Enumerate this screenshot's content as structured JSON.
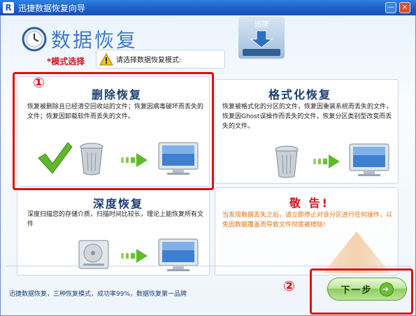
{
  "window": {
    "title": "迅捷数据恢复向导",
    "logo_letter": "R",
    "minimize_glyph": "—",
    "close_glyph": "×"
  },
  "header": {
    "title": "数据恢复",
    "mode_label": "*模式选择",
    "notice": "请选择数据恢复模式:",
    "drive_label": "迅捷"
  },
  "panels": {
    "delete": {
      "title": "删除恢复",
      "desc": "恢复被删除且已经清空回收站的文件；恢复因病毒破坏而丢失的文件；恢复因卸载软件而丢失的文件。",
      "marker": "①"
    },
    "format": {
      "title": "格式化恢复",
      "desc": "恢复被格式化的分区的文件，恢复因重装系统而丢失的文件，恢复因Ghost误操作而丢失的文件，恢复分区类别型改变而丢失的文件。"
    },
    "deep": {
      "title": "深度恢复",
      "desc": "深度扫描您的存储介质，扫描时间比较长，理论上能恢复所有文件"
    },
    "warning": {
      "title": "敬 告!",
      "desc": "当发现数据丢失之后，请立即停止对该分区进行任何操作，以免因数据覆盖而导致文件彻底被擦除!"
    }
  },
  "footer": {
    "text": "迅捷数据恢复，三种恢复模式，成功率99%，数据恢复第一品牌",
    "marker": "②",
    "next_label": "下一步",
    "next_arrow": "➜"
  },
  "colors": {
    "title_blue": "#3a78c8",
    "warning_red": "#d0141c",
    "highlight_red": "#e10e0e",
    "button_green": "#8fcc62"
  },
  "icons": [
    "clock-icon",
    "warning-icon",
    "drive-icon",
    "checkmark-icon",
    "recycle-bin-icon",
    "arrow-icon",
    "monitor-icon",
    "hard-disk-icon",
    "warning-cone-icon"
  ]
}
